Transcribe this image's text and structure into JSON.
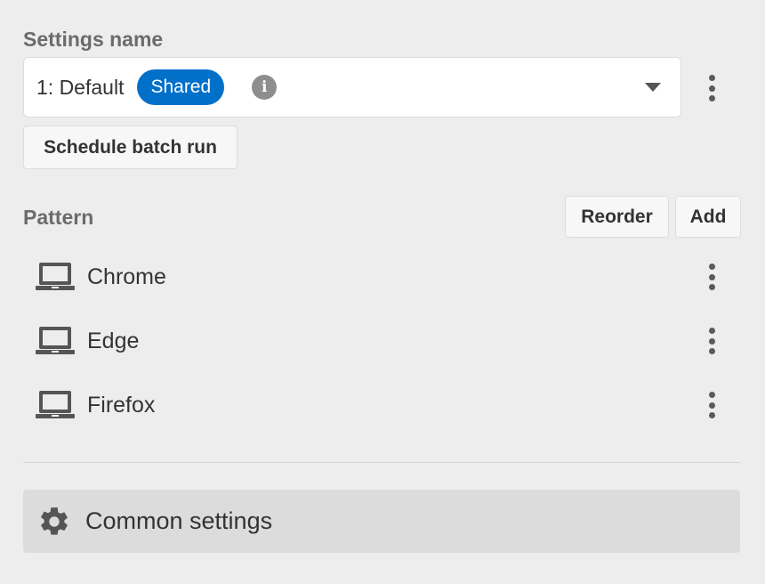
{
  "settings": {
    "label": "Settings name",
    "selected_value": "1: Default",
    "badge": "Shared",
    "info_glyph": "i",
    "badge_color": "#0070c9",
    "more_icon": "kebab-vertical-icon",
    "dropdown_icon": "caret-down-icon"
  },
  "schedule_button": "Schedule batch run",
  "pattern": {
    "label": "Pattern",
    "reorder_label": "Reorder",
    "add_label": "Add",
    "items": [
      {
        "label": "Chrome",
        "icon": "laptop-icon"
      },
      {
        "label": "Edge",
        "icon": "laptop-icon"
      },
      {
        "label": "Firefox",
        "icon": "laptop-icon"
      }
    ]
  },
  "common_settings": {
    "label": "Common settings",
    "icon": "gear-icon"
  }
}
